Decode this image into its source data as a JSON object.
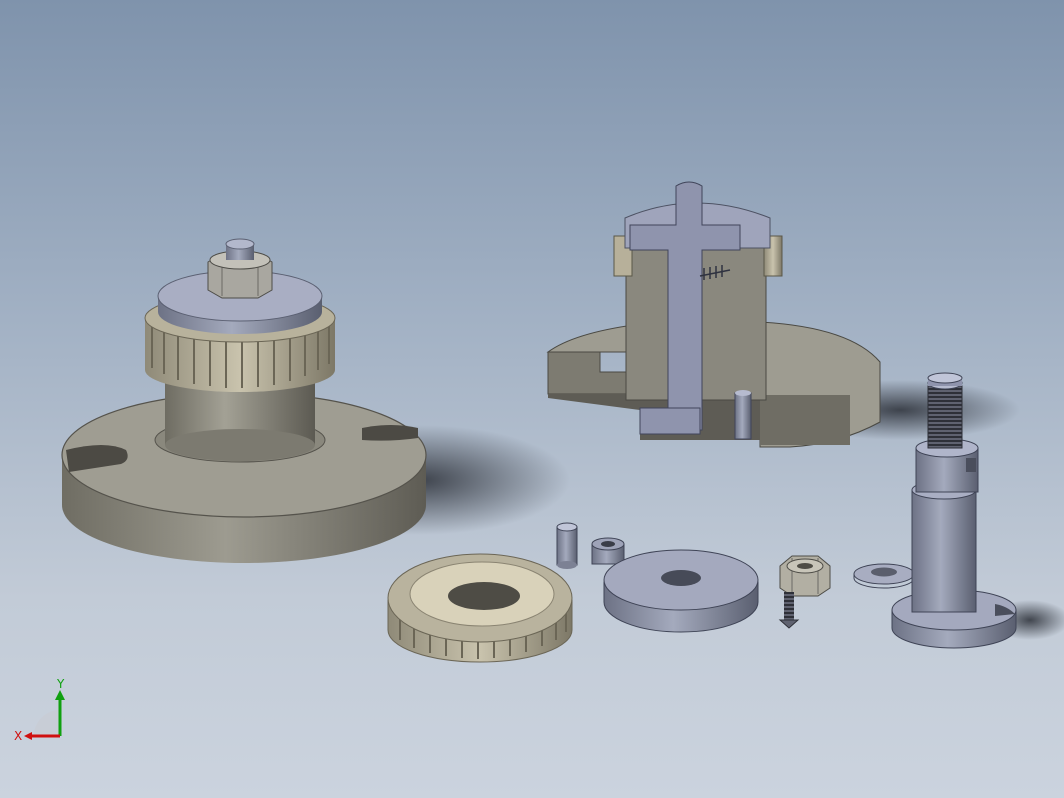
{
  "viewport": {
    "background_top": "#7f93ac",
    "background_bottom": "#cbd3de"
  },
  "colors": {
    "base_metal": "#8d8b80",
    "shaft_steel": "#9aa0b4",
    "gear_bronze": "#b7b09a",
    "shadow": "#3a3f48"
  },
  "parts": [
    "assembled-fixture",
    "sectioned-fixture",
    "spur-gear",
    "dowel-pin",
    "bushing",
    "washer-disc",
    "hex-nut",
    "set-screw",
    "flat-washer",
    "stepped-shaft"
  ],
  "triad": {
    "x_label": "X",
    "y_label": "Y",
    "x_color": "#d01010",
    "y_color": "#10a010"
  }
}
